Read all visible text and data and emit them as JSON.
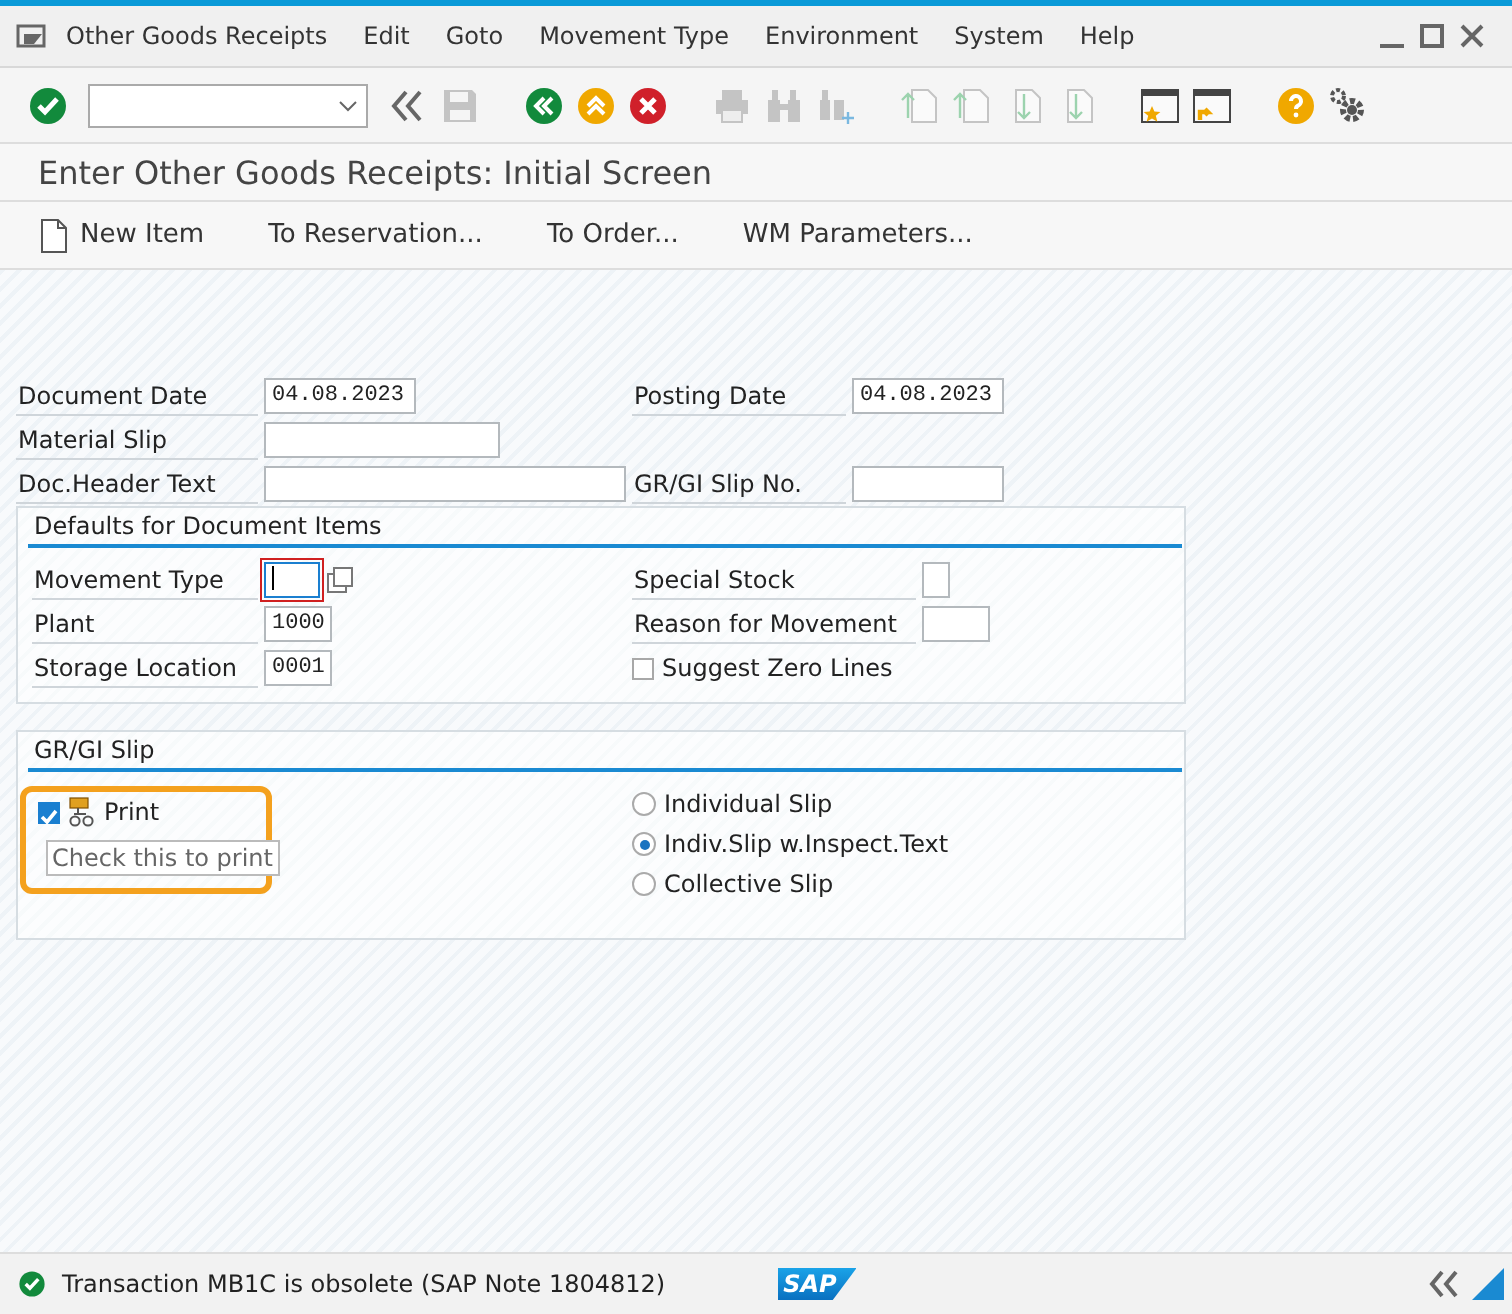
{
  "menu_bar": {
    "items": [
      "Other Goods Receipts",
      "Edit",
      "Goto",
      "Movement Type",
      "Environment",
      "System",
      "Help"
    ]
  },
  "toolbar": {
    "command_field": {
      "expanded": false
    }
  },
  "title": "Enter Other Goods Receipts: Initial Screen",
  "app_toolbar": [
    {
      "label": "New Item",
      "kind": "icon"
    },
    {
      "label": "To Reservation...",
      "kind": "text"
    },
    {
      "label": "To Order...",
      "kind": "text"
    },
    {
      "label": "WM Parameters...",
      "kind": "text"
    }
  ],
  "header_fields": [
    {
      "left": {
        "label": "Document Date",
        "value": "04.08.2023"
      },
      "right": {
        "label": "Posting Date",
        "value": "04.08.2023"
      }
    },
    {
      "left": {
        "label": "Material Slip"
      }
    },
    {
      "left": {
        "label": "Doc.Header Text"
      },
      "right": {
        "label": "GR/GI Slip No."
      }
    }
  ],
  "defaults_group": {
    "title": "Defaults for Document Items",
    "rows": [
      {
        "left": {
          "label": "Movement Type",
          "focused": true
        },
        "right": {
          "label": "Special Stock",
          "kind": "field"
        }
      },
      {
        "left": {
          "label": "Plant",
          "value": "1000"
        },
        "right": {
          "label": "Reason for Movement",
          "kind": "field"
        }
      },
      {
        "left": {
          "label": "Storage Location",
          "value": "0001"
        },
        "right": {
          "label": "Suggest Zero Lines",
          "kind": "checkbox",
          "checked": false
        }
      }
    ]
  },
  "slip_group": {
    "title": "GR/GI Slip",
    "print": {
      "label": "Print",
      "checked": true,
      "highlighted": true
    },
    "tooltip": "Check this to print",
    "options": [
      {
        "label": "Individual Slip",
        "selected": false
      },
      {
        "label": "Indiv.Slip w.Inspect.Text",
        "selected": true
      },
      {
        "label": "Collective Slip",
        "selected": false
      }
    ]
  },
  "status_bar": {
    "kind": "success",
    "message": "Transaction MB1C is obsolete (SAP Note 1804812)",
    "logo": "SAP"
  }
}
